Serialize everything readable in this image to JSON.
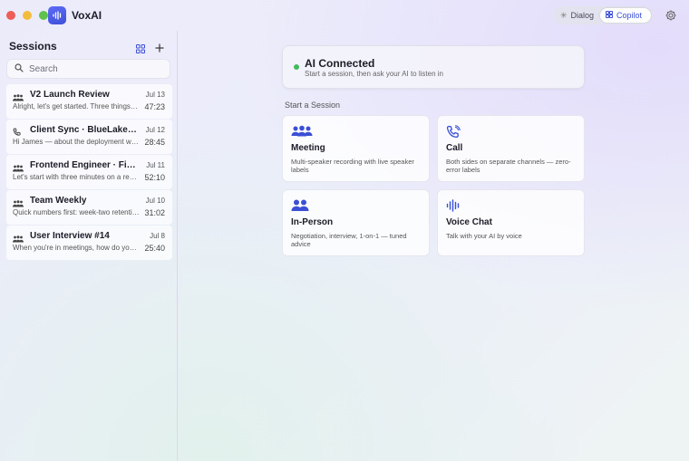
{
  "app": {
    "title": "VoxAI"
  },
  "header": {
    "modes": [
      {
        "label": "Dialog",
        "active": false
      },
      {
        "label": "Copilot",
        "active": true
      }
    ]
  },
  "sidebar": {
    "title": "Sessions",
    "search_placeholder": "Search",
    "sessions": [
      {
        "title": "V2 Launch Review",
        "date": "Jul 13",
        "snippet": "Alright, let's get started. Three things today...",
        "duration": "47:23",
        "icon": "group-icon"
      },
      {
        "title": "Client Sync · BlueLake Tech",
        "date": "Jul 12",
        "snippet": "Hi James — about the deployment window...",
        "duration": "28:45",
        "icon": "phone-icon"
      },
      {
        "title": "Frontend Engineer · Final Round",
        "date": "Jul 11",
        "snippet": "Let's start with three minutes on a recent...",
        "duration": "52:10",
        "icon": "group-icon"
      },
      {
        "title": "Team Weekly",
        "date": "Jul 10",
        "snippet": "Quick numbers first: week-two retention...",
        "duration": "31:02",
        "icon": "group-icon"
      },
      {
        "title": "User Interview #14",
        "date": "Jul 8",
        "snippet": "When you're in meetings, how do you usually...",
        "duration": "25:40",
        "icon": "group-icon"
      }
    ]
  },
  "main": {
    "status": {
      "title": "AI Connected",
      "subtitle": "Start a session, then ask your AI to listen in",
      "color": "#41ba5e"
    },
    "section_title": "Start a Session",
    "cards": [
      {
        "title": "Meeting",
        "desc": "Multi-speaker recording with live speaker labels",
        "icon": "group-icon"
      },
      {
        "title": "Call",
        "desc": "Both sides on separate channels — zero-error labels",
        "icon": "phone-icon"
      },
      {
        "title": "In-Person",
        "desc": "Negotiation, interview, 1-on-1 — tuned advice",
        "icon": "people-icon"
      },
      {
        "title": "Voice Chat",
        "desc": "Talk with your AI by voice",
        "icon": "waveform-icon"
      }
    ]
  },
  "colors": {
    "accent": "#3b4fd6",
    "status_green": "#41ba5e"
  }
}
